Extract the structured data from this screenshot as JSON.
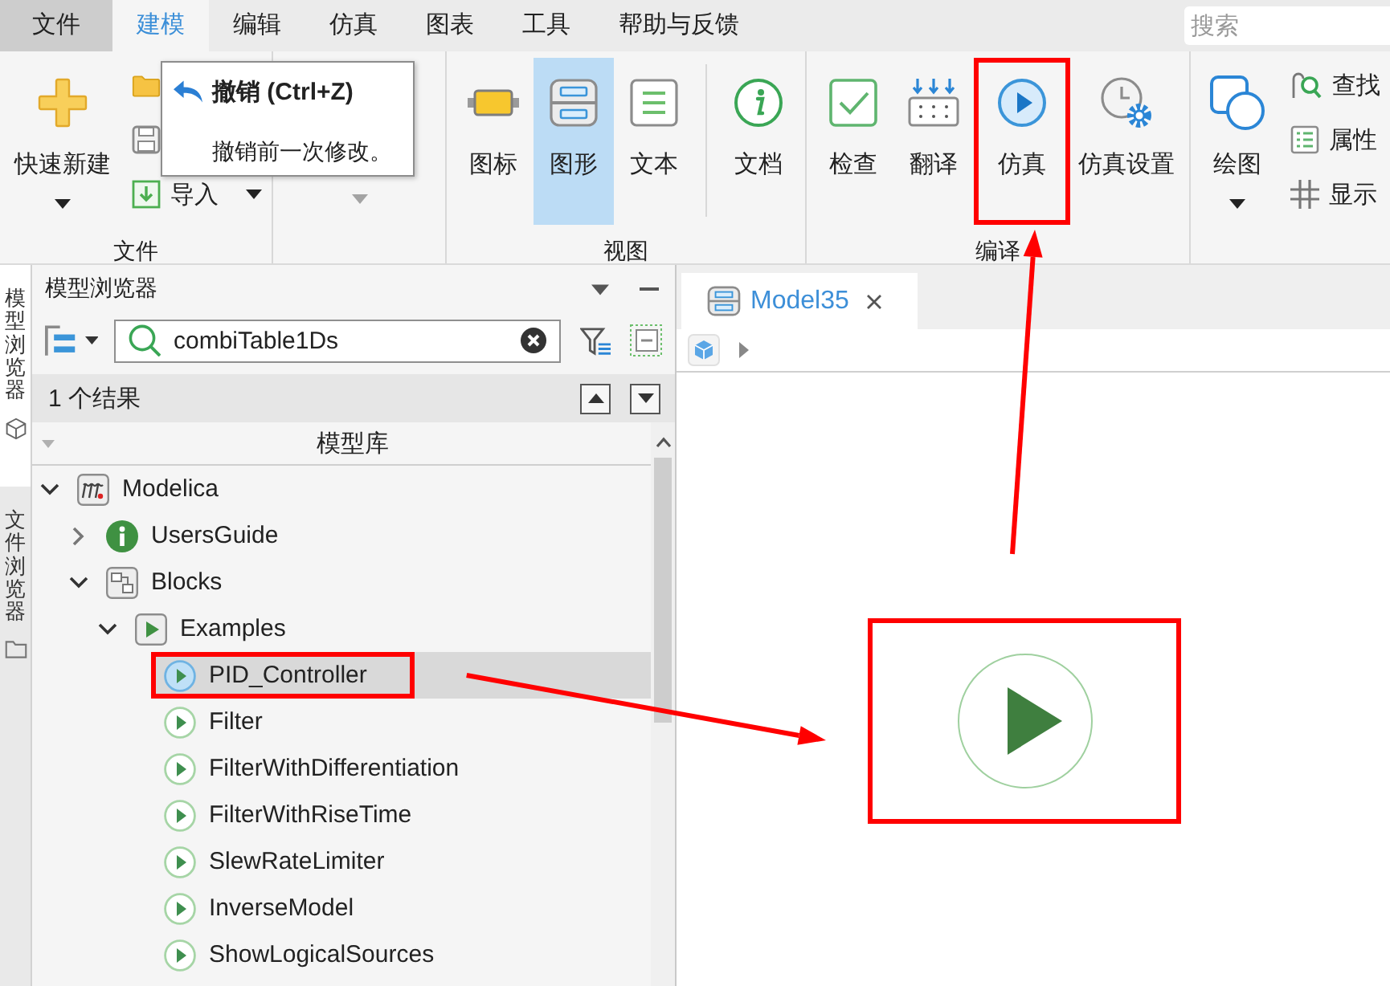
{
  "menu": {
    "tabs": [
      {
        "label": "文件",
        "kind": "application",
        "selected": false
      },
      {
        "label": "建模",
        "kind": "tab",
        "selected": true
      },
      {
        "label": "编辑",
        "kind": "tab",
        "selected": false
      },
      {
        "label": "仿真",
        "kind": "tab",
        "selected": false
      },
      {
        "label": "图表",
        "kind": "tab",
        "selected": false
      },
      {
        "label": "工具",
        "kind": "tab",
        "selected": false
      },
      {
        "label": "帮助与反馈",
        "kind": "tab",
        "selected": false
      }
    ],
    "search": {
      "placeholder": "搜索"
    }
  },
  "ribbon": {
    "groups": [
      {
        "label": "文件",
        "buttons": [
          {
            "kind": "large",
            "label": "快速新建",
            "dropdown": true
          },
          {
            "kind": "small"
          },
          {
            "kind": "small"
          },
          {
            "kind": "small",
            "label": "导入",
            "dropdown": true
          }
        ]
      },
      {
        "buttons": [
          {
            "kind": "large",
            "disabled": true,
            "dropdown": true
          }
        ]
      },
      {
        "label": "视图",
        "buttons": [
          {
            "kind": "large",
            "label": "图标",
            "selected": false
          },
          {
            "kind": "large",
            "label": "图形",
            "selected": true
          },
          {
            "kind": "large",
            "label": "文本",
            "selected": false
          },
          {
            "kind": "separator"
          },
          {
            "kind": "large",
            "label": "文档",
            "selected": false
          }
        ]
      },
      {
        "label": "编译",
        "buttons": [
          {
            "kind": "large",
            "label": "检查",
            "highlighted": false
          },
          {
            "kind": "large",
            "label": "翻译",
            "highlighted": false
          },
          {
            "kind": "large",
            "label": "仿真",
            "highlighted": true
          },
          {
            "kind": "large",
            "label": "仿真设置",
            "highlighted": false
          }
        ]
      },
      {
        "buttons": [
          {
            "kind": "large",
            "label": "绘图",
            "dropdown": true
          },
          {
            "kind": "small",
            "label": "查找"
          },
          {
            "kind": "small",
            "label": "属性"
          },
          {
            "kind": "small",
            "label": "显示"
          }
        ]
      }
    ],
    "tooltip": {
      "title": "撤销 (Ctrl+Z)",
      "text": "撤销前一次修改。"
    }
  },
  "side_tabs": [
    {
      "label": "模型浏览器",
      "selected": true
    },
    {
      "label": "文件浏览器",
      "selected": false
    }
  ],
  "model_browser": {
    "title": "模型浏览器",
    "search": {
      "value": "combiTable1Ds"
    },
    "results": "1 个结果",
    "tree": {
      "header": "模型库",
      "items": [
        {
          "label": "Modelica",
          "kind": "library",
          "expanded": true,
          "selected": false,
          "highlighted": false,
          "children": [
            {
              "label": "UsersGuide",
              "kind": "guide",
              "expanded": false,
              "selected": false,
              "highlighted": false
            },
            {
              "label": "Blocks",
              "kind": "package",
              "expanded": true,
              "selected": false,
              "highlighted": false,
              "children": [
                {
                  "label": "Examples",
                  "kind": "examples",
                  "expanded": true,
                  "selected": false,
                  "highlighted": false,
                  "children": [
                    {
                      "label": "PID_Controller",
                      "kind": "example",
                      "selected": true,
                      "highlighted": true
                    },
                    {
                      "label": "Filter",
                      "kind": "example",
                      "selected": false,
                      "highlighted": false
                    },
                    {
                      "label": "FilterWithDifferentiation",
                      "kind": "example",
                      "selected": false,
                      "highlighted": false
                    },
                    {
                      "label": "FilterWithRiseTime",
                      "kind": "example",
                      "selected": false,
                      "highlighted": false
                    },
                    {
                      "label": "SlewRateLimiter",
                      "kind": "example",
                      "selected": false,
                      "highlighted": false
                    },
                    {
                      "label": "InverseModel",
                      "kind": "example",
                      "selected": false,
                      "highlighted": false
                    },
                    {
                      "label": "ShowLogicalSources",
                      "kind": "example",
                      "selected": false,
                      "highlighted": false
                    }
                  ]
                }
              ]
            }
          ]
        }
      ]
    }
  },
  "editor": {
    "tabs": [
      {
        "label": "Model35",
        "selected": true
      }
    ]
  }
}
